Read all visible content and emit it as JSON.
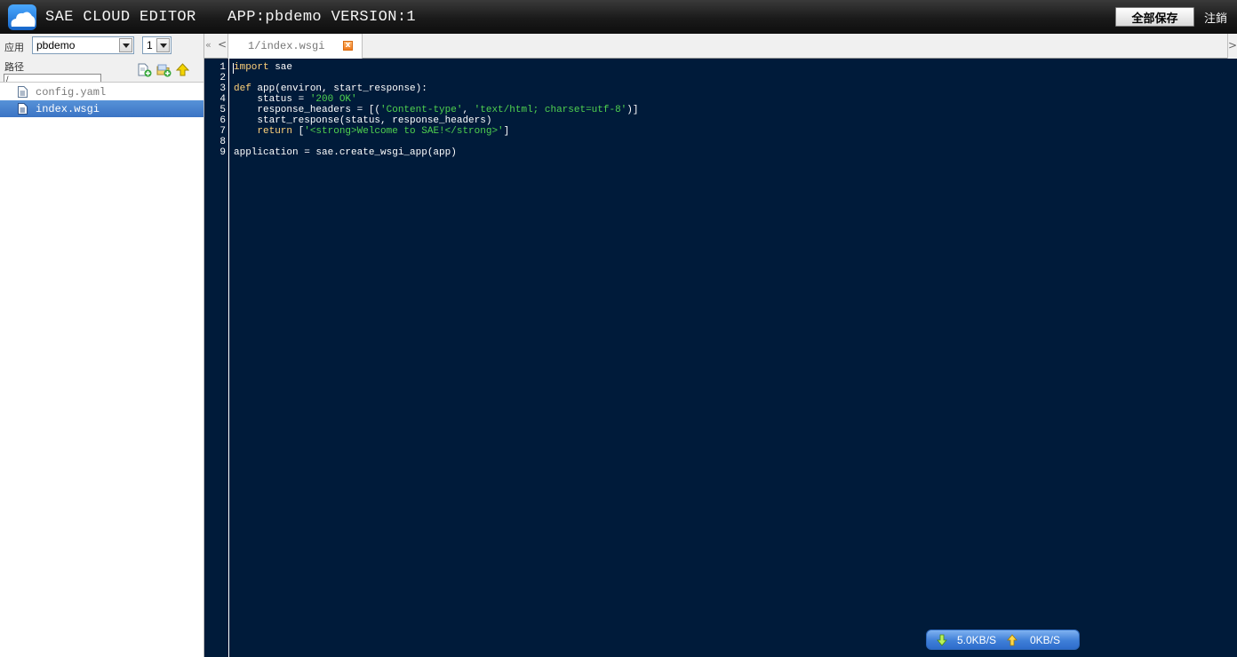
{
  "header": {
    "title": "SAE CLOUD EDITOR",
    "app_info": "APP:pbdemo VERSION:1",
    "save_all_label": "全部保存",
    "logout_label": "注銷"
  },
  "sidebar": {
    "app_label": "应用",
    "app_selected": "pbdemo",
    "version_selected": "1",
    "path_label": "路径",
    "path_value": "/",
    "files": [
      {
        "name": "config.yaml",
        "selected": false
      },
      {
        "name": "index.wsgi",
        "selected": true
      }
    ]
  },
  "tabs": [
    {
      "label": "1/index.wsgi",
      "close_label": "x"
    }
  ],
  "tab_nav": {
    "collapse": "«",
    "left": "<",
    "right": ">"
  },
  "editor": {
    "line_numbers": [
      "1",
      "2",
      "3",
      "4",
      "5",
      "6",
      "7",
      "8",
      "9"
    ],
    "code": {
      "l1_kw": "import",
      "l1_rest": " sae",
      "l3_kw": "def",
      "l3_rest": " app(environ, start_response):",
      "l4_pre": "    status = ",
      "l4_str": "'200 OK'",
      "l5_pre": "    response_headers = [(",
      "l5_str1": "'Content-type'",
      "l5_mid": ", ",
      "l5_str2": "'text/html; charset=utf-8'",
      "l5_post": ")]",
      "l6": "    start_response(status, response_headers)",
      "l7_kw": "    return",
      "l7_mid": " [",
      "l7_str": "'<strong>Welcome to SAE!</strong>'",
      "l7_post": "]",
      "l9": "application = sae.create_wsgi_app(app)"
    }
  },
  "status": {
    "download_speed": "5.0KB/S",
    "upload_speed": "0KB/S"
  },
  "colors": {
    "editor_bg": "#001b3a",
    "keyword": "#ffd27a",
    "string": "#4fd14f",
    "selection": "#3b74c4"
  }
}
